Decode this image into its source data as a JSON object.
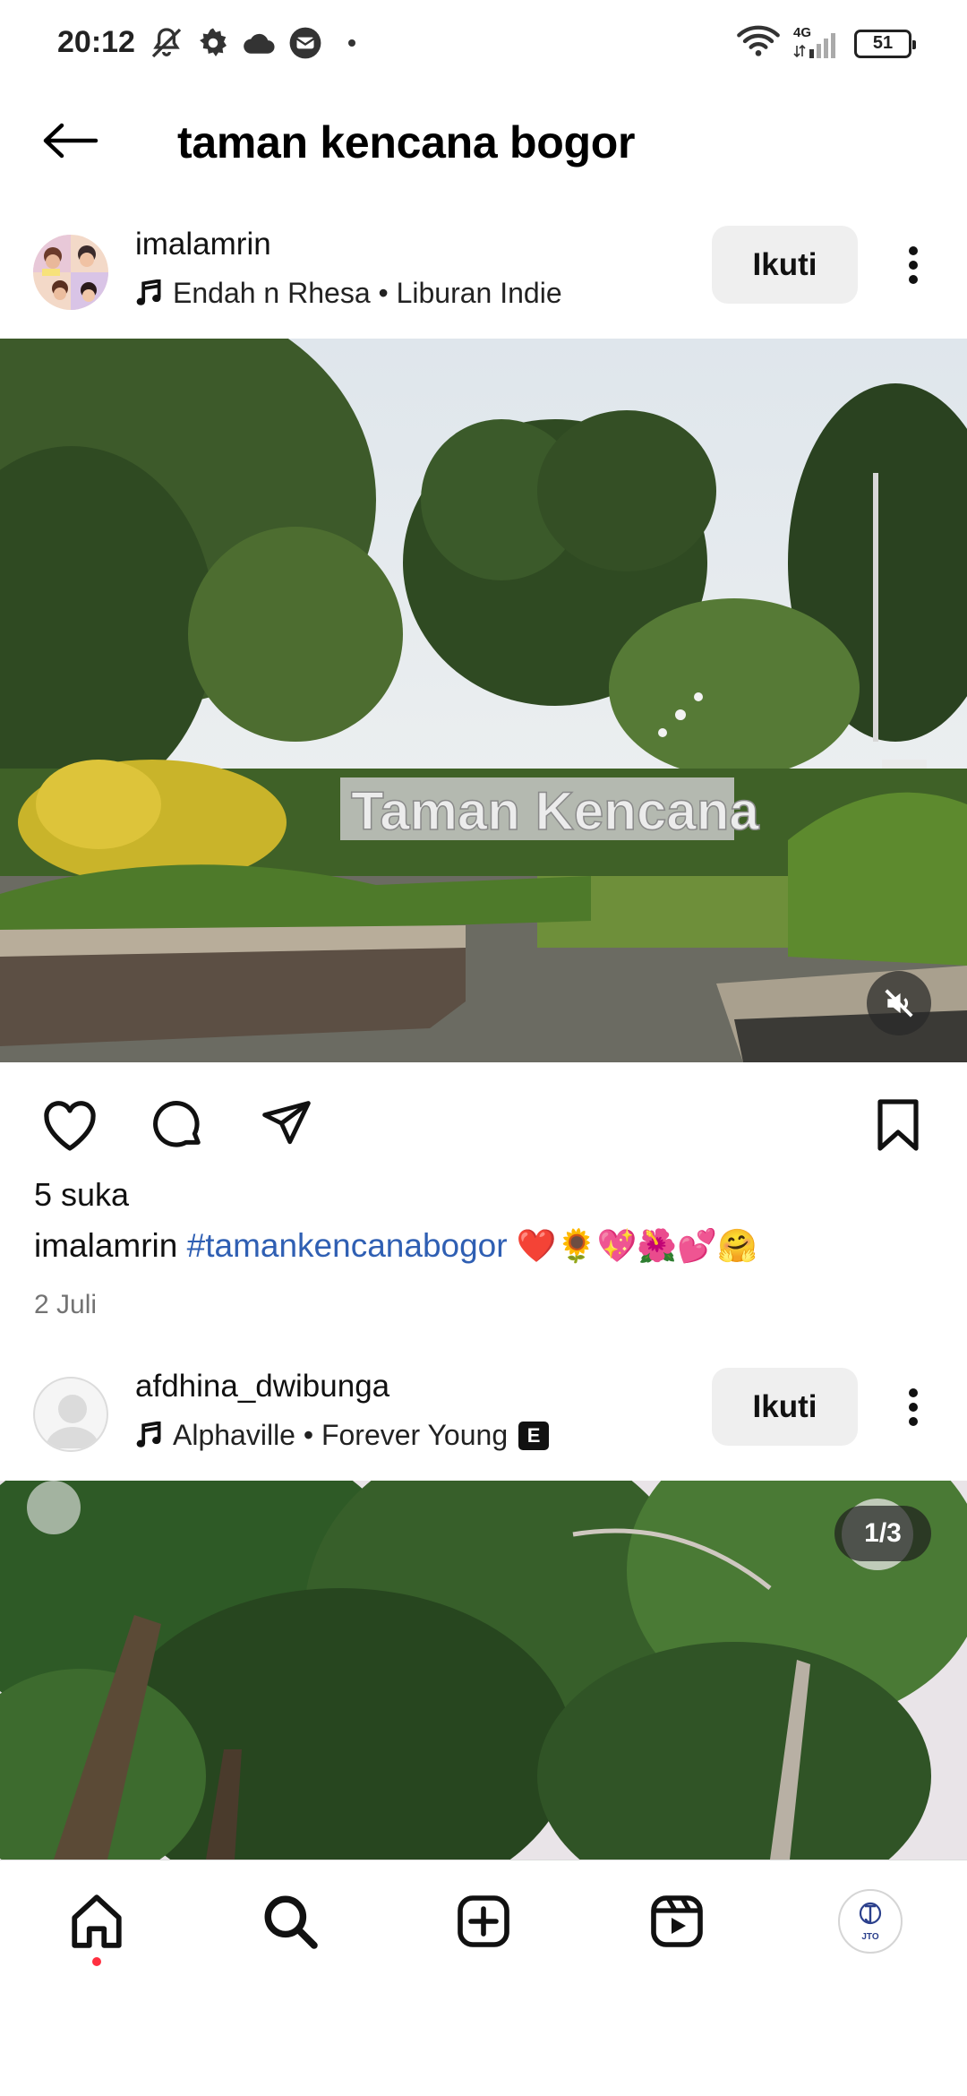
{
  "status_bar": {
    "time": "20:12",
    "network": "4G",
    "battery": "51",
    "icons": [
      "mute-icon",
      "settings-icon",
      "cloud-icon",
      "message-icon",
      "dot-icon",
      "wifi-icon",
      "signal-icon",
      "battery-icon"
    ]
  },
  "header": {
    "title": "taman kencana bogor",
    "back_icon": "arrow-left-icon"
  },
  "posts": [
    {
      "username": "imalamrin",
      "audio": "Endah n Rhesa • Liburan Indie",
      "audio_icon": "music-note-icon",
      "follow_label": "Ikuti",
      "more_icon": "more-vertical-icon",
      "media_type": "video",
      "media_icon": "volume-muted-icon",
      "likes": "5 suka",
      "caption_user": "imalamrin",
      "caption_hashtag": "#tamankencanabogor",
      "caption_emojis": "❤️🌻💖🌺💕🤗",
      "date": "2 Juli"
    },
    {
      "username": "afdhina_dwibunga",
      "audio": "Alphaville • Forever Young",
      "audio_icon": "music-note-icon",
      "explicit_badge": "E",
      "follow_label": "Ikuti",
      "more_icon": "more-vertical-icon",
      "media_type": "carousel",
      "carousel_counter": "1/3"
    }
  ],
  "actions": {
    "like_icon": "heart-icon",
    "comment_icon": "comment-icon",
    "share_icon": "send-icon",
    "save_icon": "bookmark-icon"
  },
  "bottom_nav": {
    "items": [
      "home-icon",
      "search-icon",
      "create-icon",
      "reels-icon",
      "profile-avatar"
    ],
    "profile_logo_text": "JTO",
    "active_dot_color": "#ff3040"
  },
  "colors": {
    "hashtag": "#2f5fb3",
    "follow_button_bg": "#efefef",
    "date_text": "#737373"
  }
}
